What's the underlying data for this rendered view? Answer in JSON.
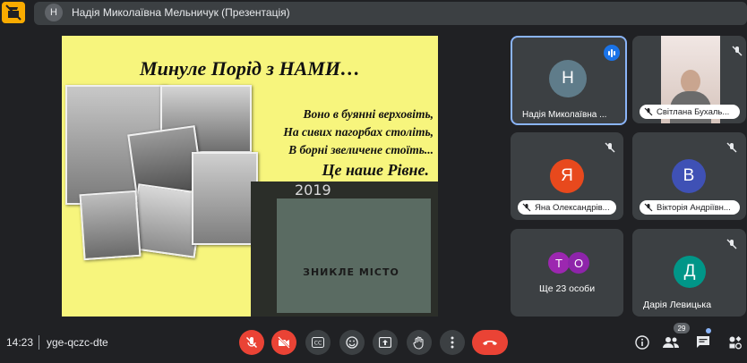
{
  "top_bar": {
    "presenter_initial": "Н",
    "presenter_label": "Надія Миколаївна Мельничук (Презентація)"
  },
  "slide": {
    "title": "Минуле Порід з НАМИ…",
    "poem": [
      "Воно в буянні верховіть,",
      "На сивих пагорбах  століть,",
      "В борні звеличене стоїть..."
    ],
    "tagline": "Це наше Рівне.",
    "book_year": "2019",
    "book_title": "ЗНИКЛЕ МІСТО"
  },
  "tiles": [
    {
      "initial": "Н",
      "name": "Надія Миколаївна ...",
      "avatar_color": "#5f7c8a",
      "state": "speaking"
    },
    {
      "initial": "",
      "name": "Світлана Бухаль...",
      "avatar_color": "",
      "state": "muted"
    },
    {
      "initial": "Я",
      "name": "Яна Олександрів...",
      "avatar_color": "#e8491d",
      "state": "muted"
    },
    {
      "initial": "В",
      "name": "Вікторія Андріївн...",
      "avatar_color": "#3f51b5",
      "state": "muted"
    },
    {
      "initials": [
        "Т",
        "О"
      ],
      "name": "Ще 23 особи",
      "avatar_colors": [
        "#9c27b0",
        "#8e24aa"
      ]
    },
    {
      "initial": "Д",
      "name": "Дарія Левицька",
      "avatar_color": "#009688",
      "state": "muted"
    }
  ],
  "bottom_bar": {
    "time": "14:23",
    "meeting_code": "yge-qczc-dte",
    "participants_count": "29",
    "controls": [
      "mic-off-icon",
      "camera-off-icon",
      "captions-icon",
      "emoji-icon",
      "present-icon",
      "raise-hand-icon",
      "more-icon",
      "end-call-icon"
    ],
    "right_controls": [
      "info-icon",
      "people-icon",
      "chat-icon",
      "activities-icon"
    ]
  },
  "colors": {
    "accent": "#8ab4f8",
    "danger": "#ea4335",
    "background": "#202124",
    "tile": "#3c4043",
    "slide_bg": "#f7f57d"
  }
}
